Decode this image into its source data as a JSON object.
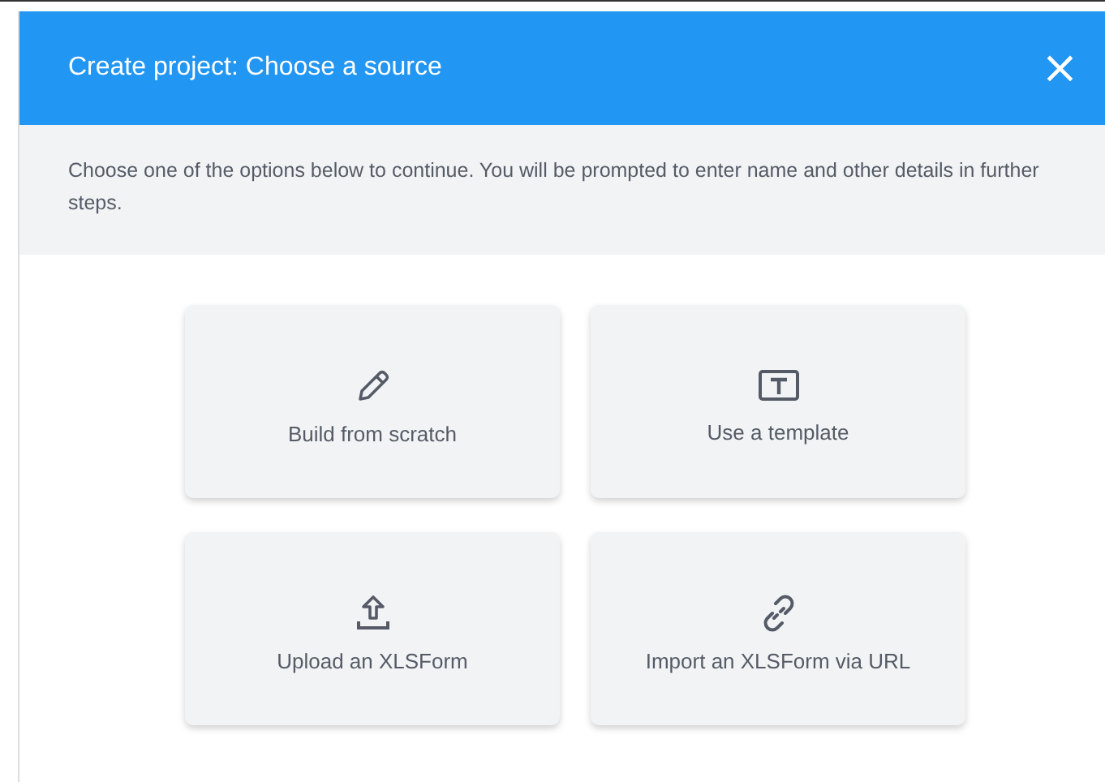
{
  "dialog": {
    "title": "Create project: Choose a source",
    "close": "×",
    "description": "Choose one of the options below to continue. You will be prompted to enter name and other details in further steps.",
    "options": [
      {
        "kind": "pencil",
        "label": "Build from scratch"
      },
      {
        "kind": "template",
        "label": "Use a template"
      },
      {
        "kind": "upload",
        "label": "Upload an XLSForm"
      },
      {
        "kind": "link",
        "label": "Import an XLSForm via URL"
      }
    ]
  }
}
